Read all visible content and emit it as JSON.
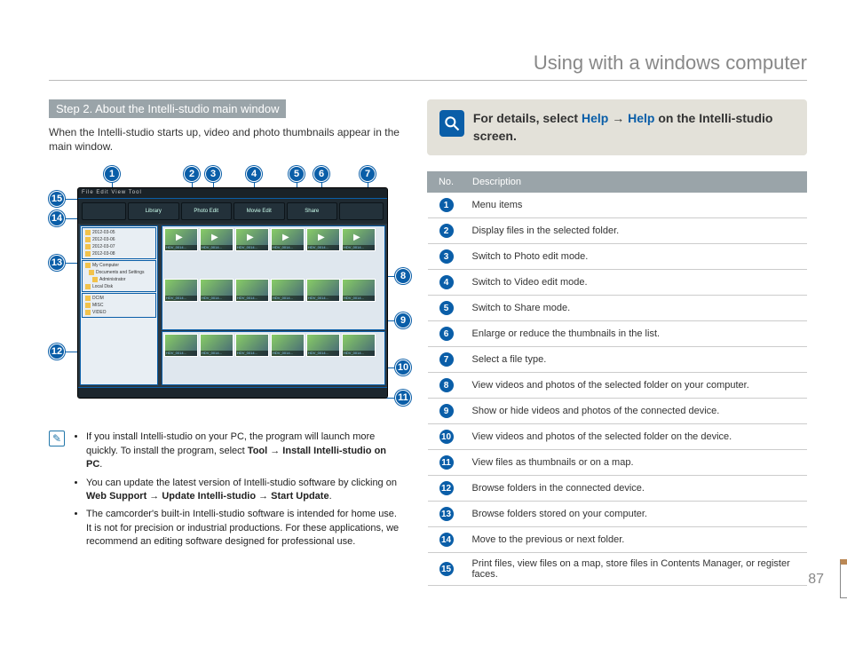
{
  "page_title": "Using with a windows computer",
  "step_title": "Step 2. About the Intelli-studio main window",
  "intro_text": "When the Intelli-studio starts up, video and photo thumbnails appear in the main window.",
  "callout_labels": [
    "1",
    "2",
    "3",
    "4",
    "5",
    "6",
    "7",
    "8",
    "9",
    "10",
    "11",
    "12",
    "13",
    "14",
    "15"
  ],
  "app": {
    "menubar": "File  Edit  View  Tool",
    "tools": [
      "Library",
      "Photo Edit",
      "Movie Edit",
      "Share"
    ],
    "tree": [
      "2012-03-05",
      "2012-03-06",
      "2012-03-07",
      "2012-03-08",
      "My Computer",
      "Documents and Settings",
      "Administrator",
      "Local Disk",
      "DCIM",
      "MISC",
      "VIDEO"
    ],
    "thumb_caption": "HDV_0014..."
  },
  "notes": [
    {
      "prefix": "If you install Intelli-studio on your PC, the program will launch more quickly. To install the program, select ",
      "bold": "Tool → Install Intelli-studio on PC",
      "suffix": "."
    },
    {
      "prefix": "You can update the latest version of Intelli-studio software by clicking on ",
      "bold": "Web Support  → Update Intelli-studio → Start Update",
      "suffix": "."
    },
    {
      "prefix": "The camcorder's built-in Intelli-studio software is intended for home use. It is not for precision or industrial productions. For these applications, we recommend an editing software designed for professional use.",
      "bold": "",
      "suffix": ""
    }
  ],
  "help": {
    "pre": "For details, select ",
    "link1": "Help",
    "arrow": " → ",
    "link2": "Help",
    "post": " on the Intelli-studio screen."
  },
  "table_headers": {
    "no": "No.",
    "desc": "Description"
  },
  "table": [
    {
      "n": "1",
      "d": "Menu items"
    },
    {
      "n": "2",
      "d": "Display files in the selected folder."
    },
    {
      "n": "3",
      "d": "Switch to Photo edit mode."
    },
    {
      "n": "4",
      "d": "Switch to Video edit mode."
    },
    {
      "n": "5",
      "d": "Switch to Share mode."
    },
    {
      "n": "6",
      "d": "Enlarge or reduce the thumbnails in the list."
    },
    {
      "n": "7",
      "d": "Select a file type."
    },
    {
      "n": "8",
      "d": "View videos and photos of the selected folder on your computer."
    },
    {
      "n": "9",
      "d": "Show or hide videos and photos of the connected device."
    },
    {
      "n": "10",
      "d": "View videos and photos of the selected folder on the device."
    },
    {
      "n": "11",
      "d": "View files as thumbnails or on a map."
    },
    {
      "n": "12",
      "d": "Browse folders in the connected device."
    },
    {
      "n": "13",
      "d": "Browse folders stored on your computer."
    },
    {
      "n": "14",
      "d": "Move to the previous or next folder."
    },
    {
      "n": "15",
      "d": "Print files, view files on a map, store files in Contents Manager, or register faces."
    }
  ],
  "page_number": "87"
}
